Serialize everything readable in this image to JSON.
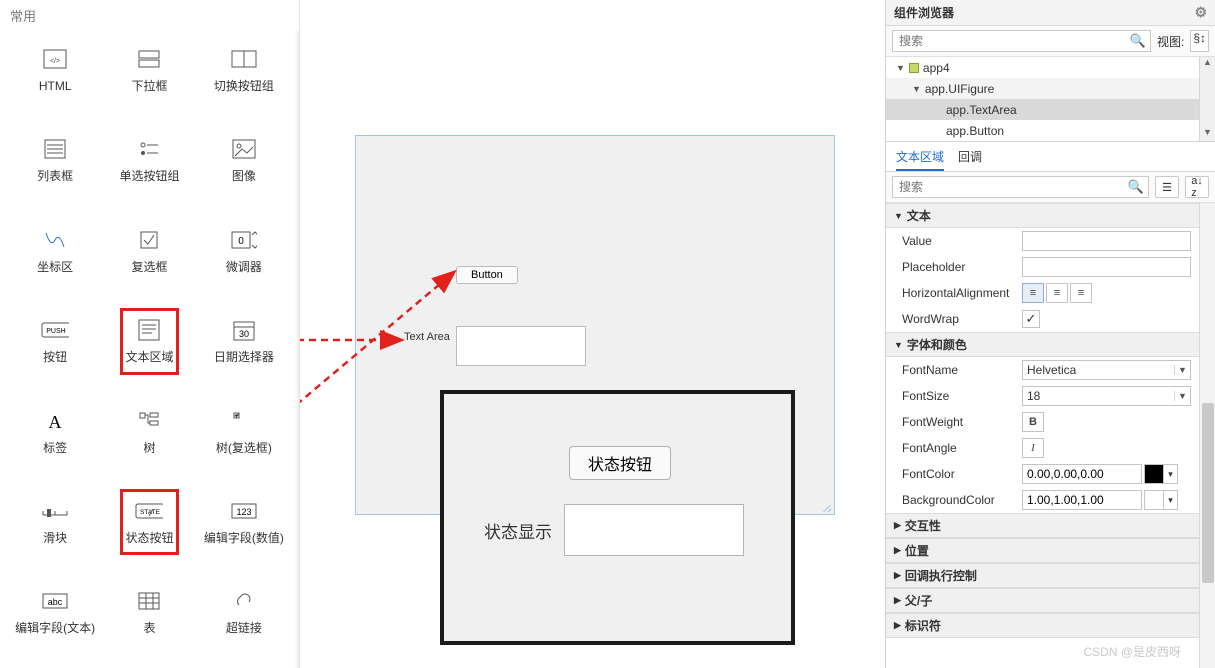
{
  "left": {
    "header": "常用",
    "items": [
      {
        "label": "HTML",
        "icon": "html-icon"
      },
      {
        "label": "下拉框",
        "icon": "dropdown-icon"
      },
      {
        "label": "切换按钮组",
        "icon": "togglegroup-icon"
      },
      {
        "label": "列表框",
        "icon": "listbox-icon"
      },
      {
        "label": "单选按钮组",
        "icon": "radiogroup-icon"
      },
      {
        "label": "图像",
        "icon": "image-icon"
      },
      {
        "label": "坐标区",
        "icon": "axes-icon"
      },
      {
        "label": "复选框",
        "icon": "checkbox-icon"
      },
      {
        "label": "微调器",
        "icon": "spinner-icon"
      },
      {
        "label": "按钮",
        "icon": "push-icon"
      },
      {
        "label": "文本区域",
        "icon": "textarea-icon",
        "highlight": true
      },
      {
        "label": "日期选择器",
        "icon": "datepicker-icon"
      },
      {
        "label": "标签",
        "icon": "label-icon"
      },
      {
        "label": "树",
        "icon": "tree-icon"
      },
      {
        "label": "树(复选框)",
        "icon": "treechk-icon"
      },
      {
        "label": "滑块",
        "icon": "slider-icon"
      },
      {
        "label": "状态按钮",
        "icon": "state-icon",
        "highlight": true
      },
      {
        "label": "编辑字段(数值)",
        "icon": "numedit-icon"
      },
      {
        "label": "编辑字段(文本)",
        "icon": "textedit-icon"
      },
      {
        "label": "表",
        "icon": "table-icon"
      },
      {
        "label": "超链接",
        "icon": "link-icon"
      }
    ]
  },
  "canvas": {
    "button_label": "Button",
    "textarea_label": "Text Area"
  },
  "overlay": {
    "button_label": "状态按钮",
    "textarea_label": "状态显示"
  },
  "browser": {
    "title": "组件浏览器",
    "search_placeholder": "搜索",
    "view_label": "视图:",
    "tree": {
      "app": "app4",
      "figure": "app.UIFigure",
      "children": [
        {
          "name": "app.TextArea",
          "selected": true
        },
        {
          "name": "app.Button",
          "selected": false
        }
      ]
    }
  },
  "inspector": {
    "tabs": {
      "active": "文本区域",
      "other": "回调"
    },
    "search_placeholder": "搜索",
    "sections": {
      "text": {
        "title": "文本",
        "open": true,
        "rows": {
          "value": "Value",
          "placeholder": "Placeholder",
          "halign": "HorizontalAlignment",
          "wordwrap": "WordWrap",
          "wordwrap_val": "✓"
        }
      },
      "font": {
        "title": "字体和颜色",
        "open": true,
        "rows": {
          "fontname": "FontName",
          "fontname_val": "Helvetica",
          "fontsize": "FontSize",
          "fontsize_val": "18",
          "fontweight": "FontWeight",
          "fontweight_val": "B",
          "fontangle": "FontAngle",
          "fontangle_val": "I",
          "fontcolor": "FontColor",
          "fontcolor_val": "0.00,0.00,0.00",
          "bgcolor": "BackgroundColor",
          "bgcolor_val": "1.00,1.00,1.00"
        }
      },
      "interact": {
        "title": "交互性"
      },
      "position": {
        "title": "位置"
      },
      "callback": {
        "title": "回调执行控制"
      },
      "parent": {
        "title": "父/子"
      },
      "id": {
        "title": "标识符"
      }
    }
  },
  "watermark": "CSDN @是皮西呀"
}
